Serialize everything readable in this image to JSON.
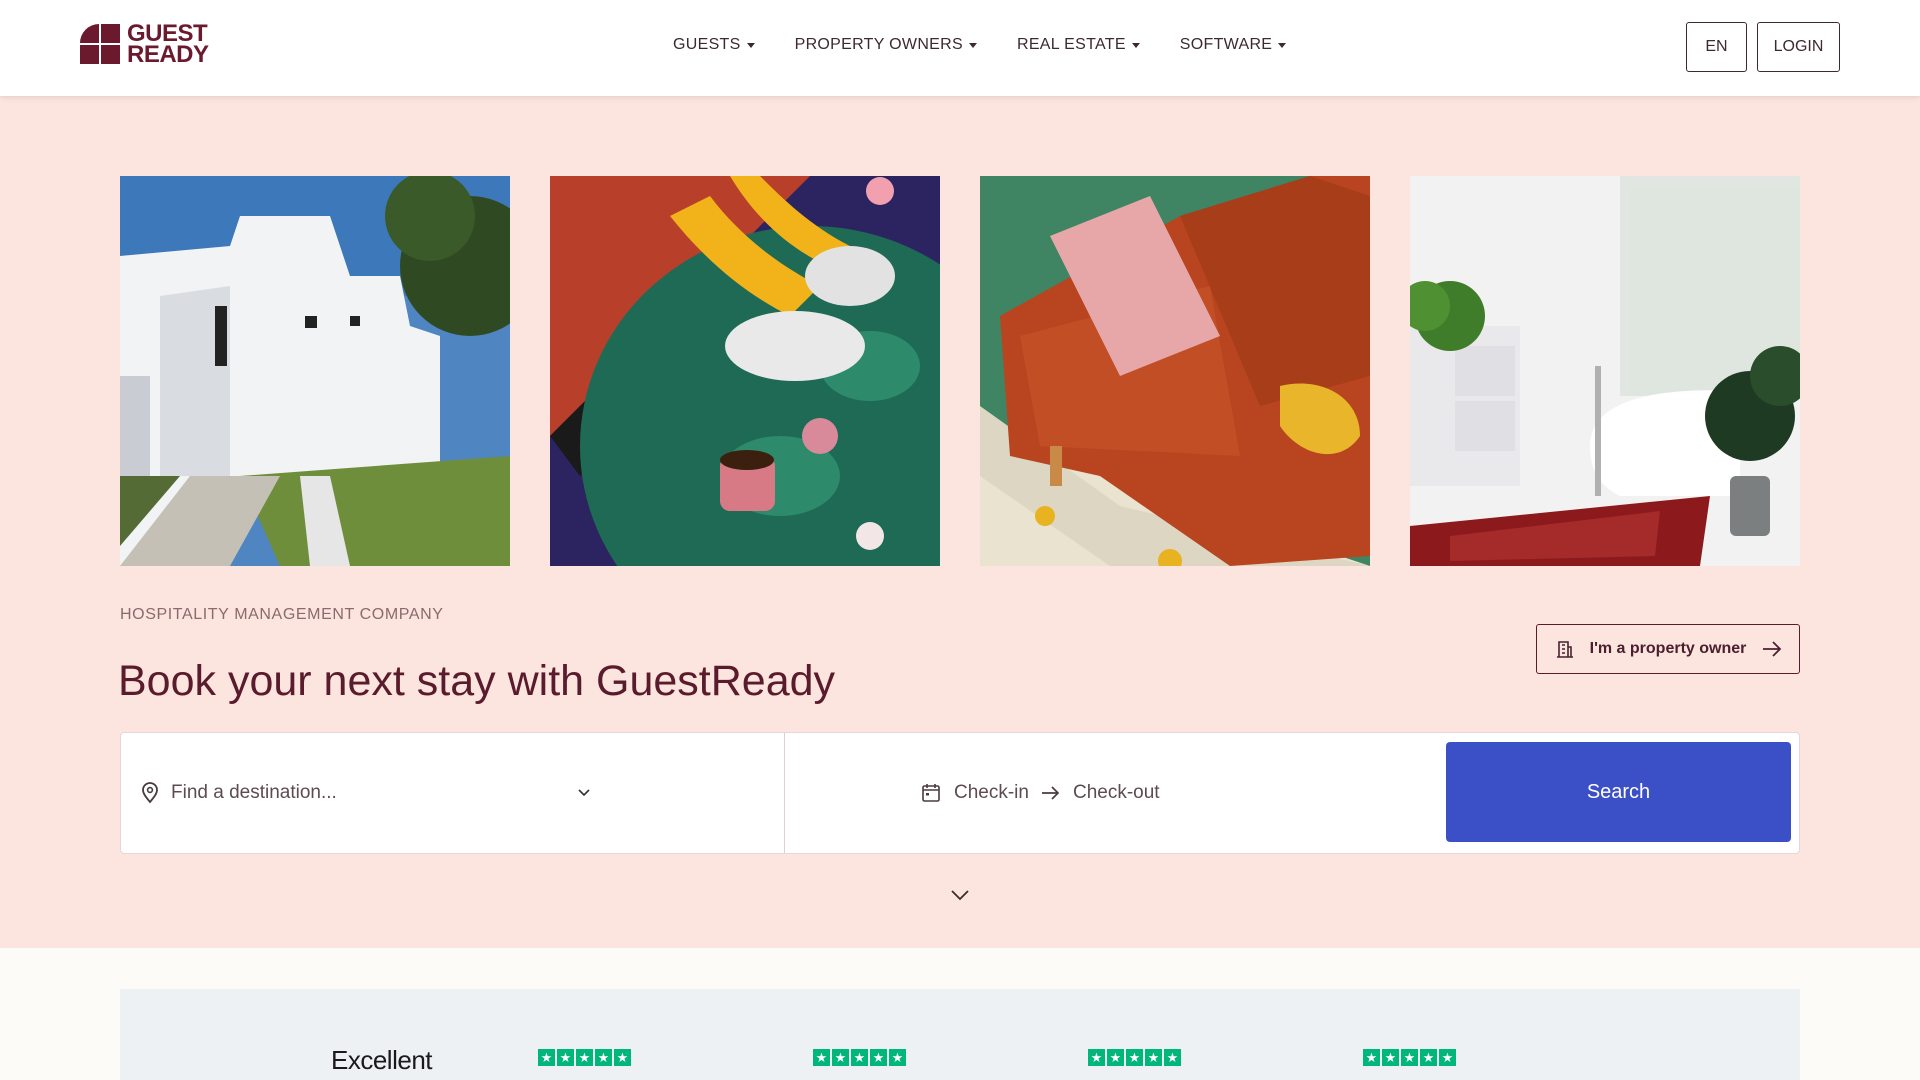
{
  "header": {
    "logo": {
      "line1": "GUEST",
      "line2": "READY",
      "icon": "guestready-logo-icon"
    },
    "nav": [
      {
        "label": "GUESTS"
      },
      {
        "label": "PROPERTY OWNERS"
      },
      {
        "label": "REAL ESTATE"
      },
      {
        "label": "SOFTWARE"
      }
    ],
    "language": "EN",
    "login": "LOGIN"
  },
  "gallery": [
    {
      "name": "white-villa-photo"
    },
    {
      "name": "slippers-rug-photo"
    },
    {
      "name": "orange-sofa-photo"
    },
    {
      "name": "bathroom-photo"
    }
  ],
  "hero": {
    "eyebrow": "HOSPITALITY MANAGEMENT COMPANY",
    "headline": "Book your next stay with GuestReady",
    "owner_button": "I'm a property owner"
  },
  "search": {
    "destination_placeholder": "Find a destination...",
    "checkin": "Check-in",
    "checkout": "Check-out",
    "button": "Search"
  },
  "reviews": {
    "rating_text": "Excellent",
    "star_color": "#00b67a"
  },
  "colors": {
    "hero_bg": "#fde5df",
    "brand": "#6b1a2e",
    "search_button": "#3b4fc7"
  }
}
